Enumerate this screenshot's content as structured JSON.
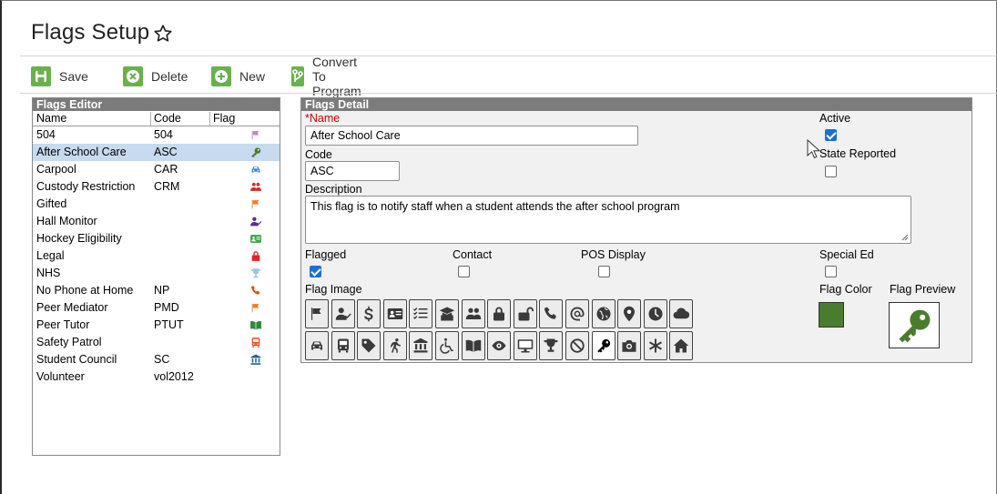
{
  "page": {
    "title": "Flags Setup"
  },
  "toolbar": {
    "save_label": "Save",
    "delete_label": "Delete",
    "new_label": "New",
    "convert_label": "Convert To Program"
  },
  "editor": {
    "title": "Flags Editor",
    "columns": {
      "name": "Name",
      "code": "Code",
      "flag": "Flag"
    },
    "rows": [
      {
        "name": "504",
        "code": "504",
        "icon": "flag-icon",
        "color": "#c084c6"
      },
      {
        "name": "After School Care",
        "code": "ASC",
        "icon": "key-icon",
        "color": "#4a7c2e",
        "selected": true
      },
      {
        "name": "Carpool",
        "code": "CAR",
        "icon": "car-icon",
        "color": "#2f7fd6"
      },
      {
        "name": "Custody Restriction",
        "code": "CRM",
        "icon": "users-icon",
        "color": "#d42a2a"
      },
      {
        "name": "Gifted",
        "code": "",
        "icon": "flag-icon",
        "color": "#f07d1c"
      },
      {
        "name": "Hall Monitor",
        "code": "",
        "icon": "user-check-icon",
        "color": "#5b2c8f"
      },
      {
        "name": "Hockey Eligibility",
        "code": "",
        "icon": "id-card-icon",
        "color": "#3aa64a"
      },
      {
        "name": "Legal",
        "code": "",
        "icon": "lock-icon",
        "color": "#e0242a"
      },
      {
        "name": "NHS",
        "code": "",
        "icon": "trophy-icon",
        "color": "#9dc6de"
      },
      {
        "name": "No Phone at Home",
        "code": "NP",
        "icon": "phone-icon",
        "color": "#d4541a"
      },
      {
        "name": "Peer Mediator",
        "code": "PMD",
        "icon": "flag-icon",
        "color": "#f07d1c"
      },
      {
        "name": "Peer Tutor",
        "code": "PTUT",
        "icon": "book-icon",
        "color": "#2e8b3a"
      },
      {
        "name": "Safety Patrol",
        "code": "",
        "icon": "bus-icon",
        "color": "#e2542a"
      },
      {
        "name": "Student Council",
        "code": "SC",
        "icon": "institution-icon",
        "color": "#1c6b8f"
      },
      {
        "name": "Volunteer",
        "code": "vol2012",
        "icon": "",
        "color": ""
      }
    ]
  },
  "detail": {
    "title": "Flags Detail",
    "name_required_mark": "*",
    "name_label": "Name",
    "name_value": "After School Care",
    "code_label": "Code",
    "code_value": "ASC",
    "description_label": "Description",
    "description_value": "This flag is to notify staff when a student attends the after school program",
    "active_label": "Active",
    "active_checked": true,
    "state_reported_label": "State Reported",
    "state_reported_checked": false,
    "flagged_label": "Flagged",
    "flagged_checked": true,
    "contact_label": "Contact",
    "contact_checked": false,
    "pos_display_label": "POS Display",
    "pos_display_checked": false,
    "special_ed_label": "Special Ed",
    "special_ed_checked": false,
    "flag_image_label": "Flag Image",
    "flag_color_label": "Flag Color",
    "flag_preview_label": "Flag Preview",
    "flag_color": "#4a7c2e",
    "flag_images_row1": [
      "flag-icon",
      "user-check-icon",
      "dollar-icon",
      "id-card-icon",
      "checklist-icon",
      "graduate-icon",
      "users-icon",
      "lock-icon",
      "unlock-icon",
      "phone-icon",
      "at-icon",
      "globe-icon",
      "map-pin-icon",
      "clock-icon",
      "cloud-icon"
    ],
    "flag_images_row2": [
      "car-icon",
      "bus-icon",
      "tag-icon",
      "running-icon",
      "institution-icon",
      "wheelchair-icon",
      "book-icon",
      "eye-icon",
      "monitor-icon",
      "trophy-icon",
      "ban-icon",
      "key-icon",
      "camera-icon",
      "asterisk-icon",
      "home-icon"
    ],
    "selected_image": "key-icon"
  }
}
